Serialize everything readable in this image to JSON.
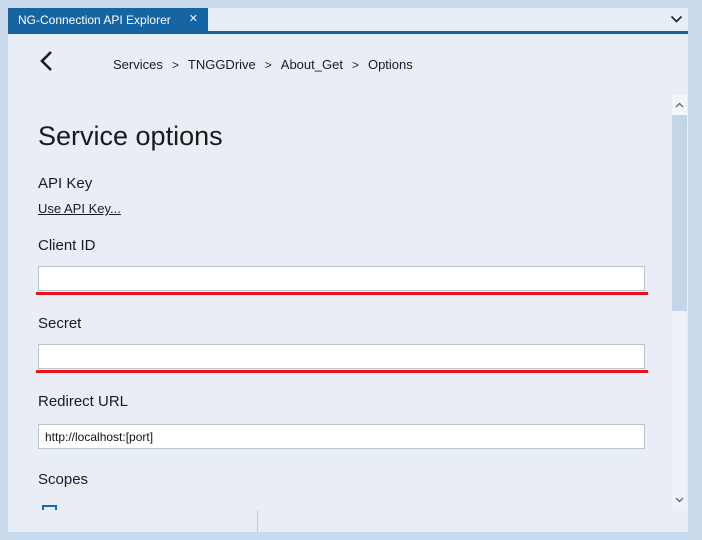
{
  "colors": {
    "accent_blue": "#1764a3",
    "error_red": "#e8121f",
    "frame": "#c9dbec",
    "content_bg": "#e9eef6"
  },
  "tab_bar": {
    "tab_title": "NG-Connection API Explorer"
  },
  "icons": {
    "close": "✕",
    "chevron_down": "chevron-down",
    "back": "chevron-left",
    "scroll_up": "chevron-up",
    "scroll_down": "chevron-down"
  },
  "breadcrumb": {
    "separator": ">",
    "items": [
      "Services",
      "TNGGDrive",
      "About_Get",
      "Options"
    ]
  },
  "page": {
    "title": "Service options",
    "api_key_label": "API Key",
    "api_key_link": "Use API Key...",
    "fields": [
      {
        "label": "Client ID",
        "value": "",
        "has_error": true
      },
      {
        "label": "Secret",
        "value": "",
        "has_error": true
      },
      {
        "label": "Redirect URL",
        "value": "http://localhost:[port]",
        "has_error": false
      }
    ],
    "scopes_label": "Scopes"
  }
}
